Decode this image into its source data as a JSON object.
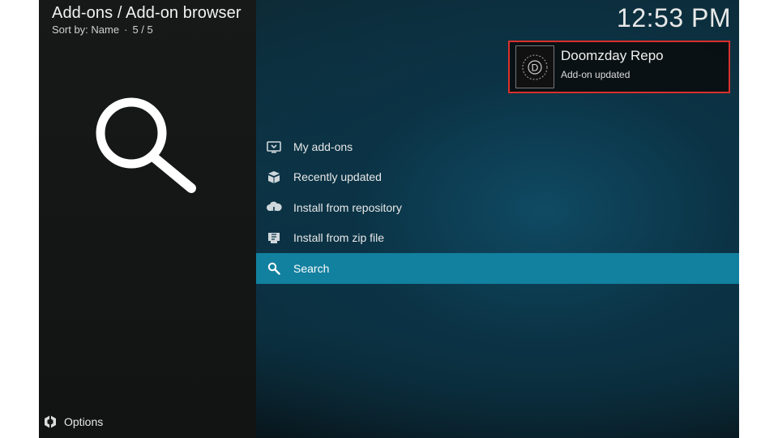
{
  "header": {
    "title": "Add-ons / Add-on browser",
    "sort_label": "Sort by: Name",
    "position": "5 / 5"
  },
  "clock": "12:53 PM",
  "notification": {
    "title": "Doomzday Repo",
    "message": "Add-on updated",
    "thumb_letter": "D",
    "border_color": "#d9302c"
  },
  "menu": {
    "items": [
      {
        "label": "My add-ons",
        "icon": "monitor-box-icon"
      },
      {
        "label": "Recently updated",
        "icon": "open-box-icon"
      },
      {
        "label": "Install from repository",
        "icon": "cloud-download-icon"
      },
      {
        "label": "Install from zip file",
        "icon": "zip-file-icon"
      },
      {
        "label": "Search",
        "icon": "search-icon",
        "selected": true
      }
    ],
    "accent": "#12809f"
  },
  "footer": {
    "options_label": "Options"
  }
}
